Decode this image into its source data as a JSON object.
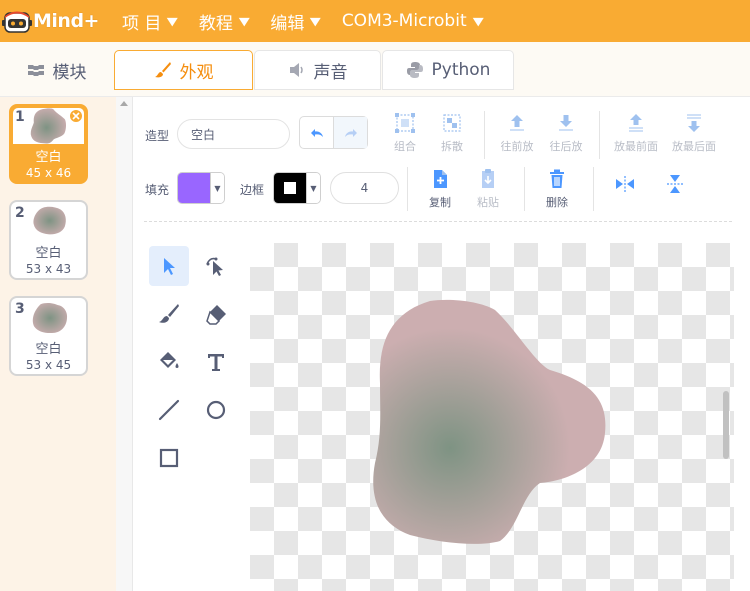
{
  "menubar": {
    "logo_text": "Mind+",
    "items": [
      {
        "label": "项 目"
      },
      {
        "label": "教程"
      },
      {
        "label": "编辑"
      },
      {
        "label": "COM3-Microbit"
      }
    ],
    "bg_color": "#f9ab33"
  },
  "tabs": [
    {
      "label": "模块",
      "icon": "blocks-icon"
    },
    {
      "label": "外观",
      "icon": "paintbrush-icon",
      "active": true
    },
    {
      "label": "声音",
      "icon": "speaker-icon"
    },
    {
      "label": "Python",
      "icon": "python-icon"
    }
  ],
  "costumes": [
    {
      "number": "1",
      "name": "空白",
      "size": "45 x 46",
      "selected": true
    },
    {
      "number": "2",
      "name": "空白",
      "size": "53 x 43",
      "selected": false
    },
    {
      "number": "3",
      "name": "空白",
      "size": "53 x 45",
      "selected": false
    }
  ],
  "editor": {
    "costume_label": "造型",
    "costume_name": "空白",
    "toolbar": {
      "group": "组合",
      "ungroup": "拆散",
      "forward": "往前放",
      "backward": "往后放",
      "front": "放最前面",
      "back": "放最后面",
      "copy": "复制",
      "paste": "粘贴",
      "delete": "删除"
    },
    "fill_label": "填充",
    "fill_color": "#9966ff",
    "outline_label": "边框",
    "outline_color": "#000000",
    "outline_width": "4"
  },
  "shape": {
    "center_color": "#7e9383",
    "edge_color": "#ccaeb0"
  }
}
